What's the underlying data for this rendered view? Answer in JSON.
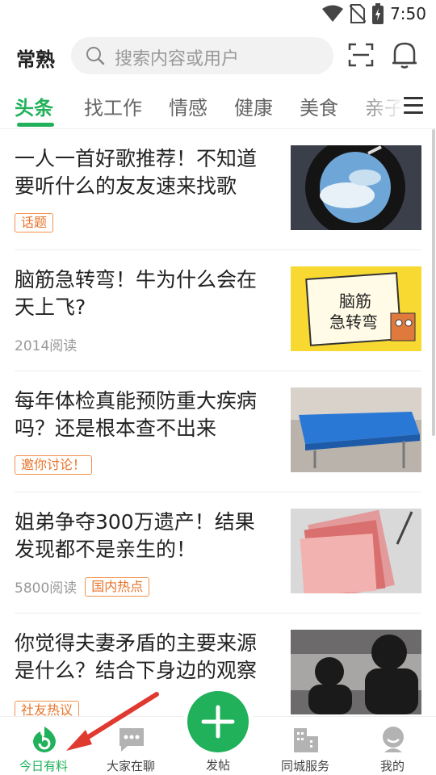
{
  "status_bar": {
    "time": "7:50"
  },
  "header": {
    "city": "常熟",
    "search_placeholder": "搜索内容或用户",
    "icons": [
      "scan-icon",
      "bell-icon"
    ]
  },
  "tabs": [
    {
      "label": "头条",
      "active": true
    },
    {
      "label": "找工作"
    },
    {
      "label": "情感"
    },
    {
      "label": "健康"
    },
    {
      "label": "美食"
    },
    {
      "label": "亲子"
    }
  ],
  "feed": [
    {
      "title": "一人一首好歌推荐！不知道要听什么的友友速来找歌",
      "reads": "",
      "tag": "话题"
    },
    {
      "title": "脑筋急转弯！牛为什么会在天上飞?",
      "reads": "2014阅读",
      "tag": "",
      "thumb_text_1": "脑筋",
      "thumb_text_2": "急转弯"
    },
    {
      "title": "每年体检真能预防重大疾病吗？还是根本查不出来",
      "reads": "",
      "tag": "邀你讨论！"
    },
    {
      "title": "姐弟争夺300万遗产！结果发现都不是亲生的！",
      "reads": "5800阅读",
      "tag": "国内热点"
    },
    {
      "title": "你觉得夫妻矛盾的主要来源是什么？结合下身边的观察",
      "reads": "",
      "tag": "社友热议"
    }
  ],
  "bottom_nav": [
    {
      "label": "今日有料",
      "icon": "today-icon",
      "active": true
    },
    {
      "label": "大家在聊",
      "icon": "chat-icon"
    },
    {
      "label": "发帖",
      "icon": "plus-icon"
    },
    {
      "label": "同城服务",
      "icon": "city-buildings-icon"
    },
    {
      "label": "我的",
      "icon": "profile-icon"
    }
  ],
  "colors": {
    "accent": "#20b15a",
    "tag": "#e8742a",
    "annotation_arrow": "#e03a30"
  }
}
